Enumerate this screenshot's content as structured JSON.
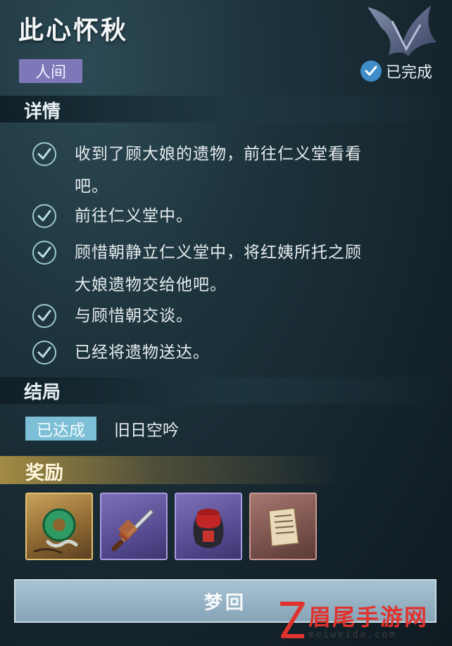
{
  "quest": {
    "title": "此心怀秋",
    "realm_tag": "人间",
    "status": "已完成"
  },
  "details": {
    "heading": "详情",
    "tasks": [
      {
        "lines": [
          "收到了顾大娘的遗物，前往仁义堂看看",
          "吧。"
        ]
      },
      {
        "lines": [
          "前往仁义堂中。"
        ]
      },
      {
        "lines": [
          "顾惜朝静立仁义堂中，将红姨所托之顾",
          "大娘遗物交给他吧。"
        ]
      },
      {
        "lines": [
          "与顾惜朝交谈。"
        ]
      },
      {
        "lines": [
          "已经将遗物送达。"
        ]
      }
    ]
  },
  "ending": {
    "heading": "结局",
    "badge": "已达成",
    "name": "旧日空吟"
  },
  "rewards": {
    "heading": "奖励",
    "items": [
      {
        "icon": "jade-pendant-icon",
        "rarity": "gold"
      },
      {
        "icon": "dagger-icon",
        "rarity": "purple"
      },
      {
        "icon": "wine-jar-icon",
        "rarity": "purple"
      },
      {
        "icon": "scroll-book-icon",
        "rarity": "brown"
      }
    ]
  },
  "actions": {
    "return_label": "梦回"
  },
  "watermark": {
    "name": "眉尾手游网",
    "url": "meiweida.com"
  },
  "colors": {
    "realm_tag": "#7f78b8",
    "status_check": "#3f8cc9",
    "ending_badge": "#7dbfd6",
    "reward_gold": "#c9a25a",
    "reward_purple": "#7d70b8",
    "reward_brown": "#a57770",
    "return_button": "#a8c2d2"
  }
}
